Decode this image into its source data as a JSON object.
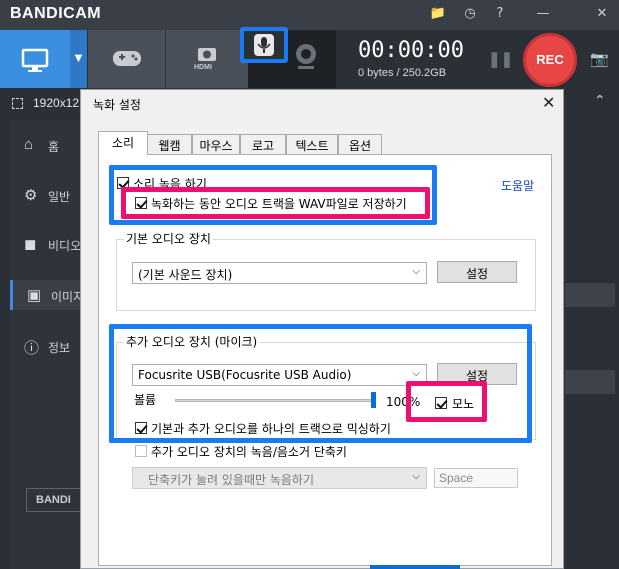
{
  "app": {
    "logo": "BANDICAM",
    "timer": "00:00:00",
    "storage": "0 bytes / 250.2GB",
    "rec_label": "REC",
    "hdmi_label": "HDMI",
    "resolution": "1920x12",
    "colors": {
      "accent": "#3b8fe0",
      "rec": "#e84545",
      "highlight_blue": "#1a7cf5",
      "highlight_pink": "#ec1070"
    }
  },
  "sidebar": {
    "items": [
      {
        "label": "홈",
        "icon": "home-icon"
      },
      {
        "label": "일반",
        "icon": "gear-icon"
      },
      {
        "label": "비디오",
        "icon": "video-icon"
      },
      {
        "label": "이미지",
        "icon": "image-icon"
      },
      {
        "label": "정보",
        "icon": "info-icon"
      }
    ],
    "footer_label": "BANDI"
  },
  "dialog": {
    "title": "녹화 설정",
    "tabs": [
      "소리",
      "웹캠",
      "마우스",
      "로고",
      "텍스트",
      "옵션"
    ],
    "active_tab": "소리",
    "help_link": "도움말",
    "record_sound": {
      "label": "소리 녹음 하기",
      "checked": true
    },
    "save_wav": {
      "label": "녹화하는 동안 오디오 트랙을 WAV파일로 저장하기",
      "checked": true
    },
    "primary_group": {
      "title": "기본 오디오 장치",
      "device": "(기본 사운드 장치)",
      "settings_label": "설정"
    },
    "extra_group": {
      "title": "추가 오디오 장치 (마이크)",
      "device": "Focusrite USB(Focusrite USB Audio)",
      "settings_label": "설정",
      "volume_label": "볼륨",
      "volume_value": "100%",
      "volume_level": 1.0,
      "mono": {
        "label": "모노",
        "checked": true
      },
      "mix": {
        "label": "기본과 추가 오디오를 하나의 트랙으로 믹싱하기",
        "checked": true
      }
    },
    "hotkey": {
      "label": "추가 오디오 장치의 녹음/음소거 단축키",
      "checked": false,
      "mode": "단축키가 눌려 있을때만 녹음하기",
      "key": "Space"
    }
  }
}
